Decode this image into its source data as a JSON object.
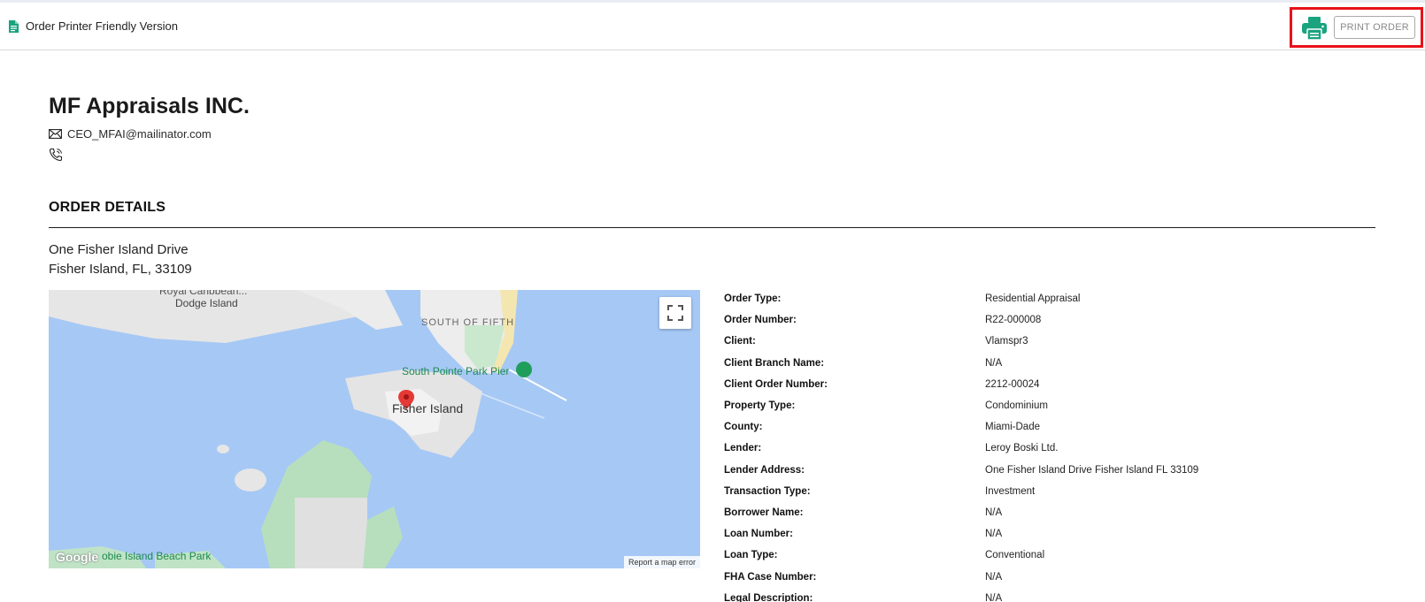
{
  "header": {
    "title": "Order Printer Friendly Version",
    "print_button": "PRINT ORDER"
  },
  "company": {
    "name": "MF Appraisals INC.",
    "email": "CEO_MFAI@mailinator.com"
  },
  "section": {
    "title": "ORDER DETAILS"
  },
  "address": {
    "line1": "One Fisher Island Drive",
    "line2": "Fisher Island, FL, 33109"
  },
  "map": {
    "labels": {
      "royal": "Royal Caribbean...",
      "dodge": "Dodge Island",
      "south_of_fifth": "SOUTH OF FIFTH",
      "pier": "South Pointe Park Pier",
      "fisher": "Fisher Island",
      "beach_park": "obie Island Beach Park",
      "google": "Google"
    },
    "report": "Report a map error",
    "colors": {
      "water": "#a6c8f5",
      "land": "#eaeaea",
      "park": "#bfe3c4",
      "pin": "#e53935"
    }
  },
  "details": [
    {
      "label": "Order Type:",
      "value": "Residential Appraisal"
    },
    {
      "label": "Order Number:",
      "value": "R22-000008"
    },
    {
      "label": "Client:",
      "value": "Vlamspr3"
    },
    {
      "label": "Client Branch Name:",
      "value": "N/A"
    },
    {
      "label": "Client Order Number:",
      "value": "2212-00024"
    },
    {
      "label": "Property Type:",
      "value": "Condominium"
    },
    {
      "label": "County:",
      "value": "Miami-Dade"
    },
    {
      "label": "Lender:",
      "value": "Leroy Boski Ltd."
    },
    {
      "label": "Lender Address:",
      "value": "One Fisher Island Drive Fisher Island FL 33109"
    },
    {
      "label": "Transaction Type:",
      "value": "Investment"
    },
    {
      "label": "Borrower Name:",
      "value": "N/A"
    },
    {
      "label": "Loan Number:",
      "value": "N/A"
    },
    {
      "label": "Loan Type:",
      "value": "Conventional"
    },
    {
      "label": "FHA Case Number:",
      "value": "N/A"
    },
    {
      "label": "Legal Description:",
      "value": "N/A"
    }
  ],
  "colors": {
    "accent": "#1aa37f",
    "highlight": "#e8121a"
  }
}
